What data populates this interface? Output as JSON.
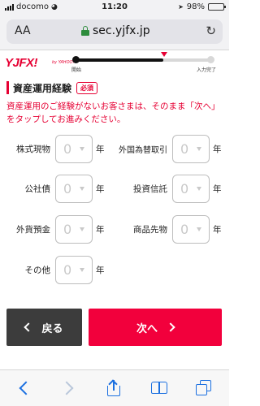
{
  "status_bar": {
    "carrier": "docomo",
    "time": "11:20",
    "battery": "98%",
    "battery_level": 0.98
  },
  "browser": {
    "text_size_label": "AA",
    "url": "sec.yjfx.jp"
  },
  "brand": {
    "logo": "YJFX!",
    "logo_sub": "by YAHOO!",
    "accent_color": "#e60033"
  },
  "progress": {
    "start_label": "開始",
    "end_label": "入力完了",
    "fraction": 0.65
  },
  "section": {
    "title": "資産運用経験",
    "required_badge": "必須",
    "note": "資産運用のご経験がないお客さまは、そのまま「次へ」をタップしてお進みください。"
  },
  "fields": [
    {
      "label": "株式現物",
      "value": "0",
      "unit": "年"
    },
    {
      "label": "外国為替取引",
      "value": "0",
      "unit": "年"
    },
    {
      "label": "公社債",
      "value": "0",
      "unit": "年"
    },
    {
      "label": "投資信託",
      "value": "0",
      "unit": "年"
    },
    {
      "label": "外貨預金",
      "value": "0",
      "unit": "年"
    },
    {
      "label": "商品先物",
      "value": "0",
      "unit": "年"
    },
    {
      "label": "その他",
      "value": "0",
      "unit": "年"
    }
  ],
  "buttons": {
    "back": "戻る",
    "next": "次へ"
  },
  "toolbar": {
    "icons": [
      "back-icon",
      "forward-icon",
      "share-icon",
      "bookmarks-icon",
      "tabs-icon"
    ]
  }
}
